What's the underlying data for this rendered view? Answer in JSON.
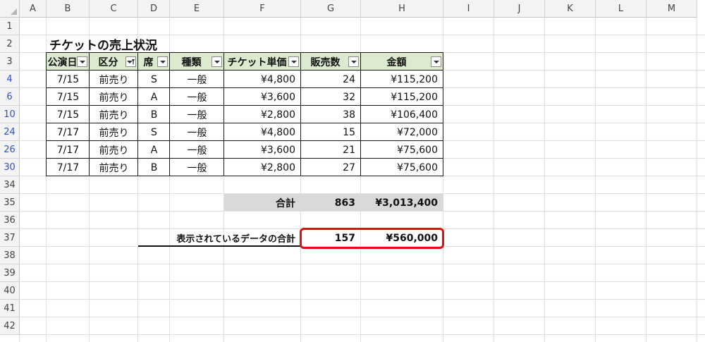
{
  "column_headers": [
    "A",
    "B",
    "C",
    "D",
    "E",
    "F",
    "G",
    "H",
    "I",
    "J",
    "K",
    "L",
    "M"
  ],
  "row_headers": [
    "1",
    "2",
    "3",
    "4",
    "6",
    "10",
    "24",
    "26",
    "30",
    "34",
    "35",
    "36",
    "37",
    "38",
    "39",
    "40",
    "41",
    "42"
  ],
  "title": "チケットの売上状況",
  "table": {
    "headers": [
      "公演日",
      "区分",
      "席",
      "種類",
      "チケット単価",
      "販売数",
      "金額"
    ],
    "rows": [
      [
        "7/15",
        "前売り",
        "S",
        "一般",
        "¥4,800",
        "24",
        "¥115,200"
      ],
      [
        "7/15",
        "前売り",
        "A",
        "一般",
        "¥3,600",
        "32",
        "¥115,200"
      ],
      [
        "7/15",
        "前売り",
        "B",
        "一般",
        "¥2,800",
        "38",
        "¥106,400"
      ],
      [
        "7/17",
        "前売り",
        "S",
        "一般",
        "¥4,800",
        "15",
        "¥72,000"
      ],
      [
        "7/17",
        "前売り",
        "A",
        "一般",
        "¥3,600",
        "21",
        "¥75,600"
      ],
      [
        "7/17",
        "前売り",
        "B",
        "一般",
        "¥2,800",
        "27",
        "¥75,600"
      ]
    ]
  },
  "total": {
    "label": "合計",
    "count": "863",
    "amount": "¥3,013,400"
  },
  "visible_total": {
    "label": "表示されているデータの合計",
    "count": "157",
    "amount": "¥560,000"
  },
  "colors": {
    "header_fill": "#dcebcf",
    "total_fill": "#d9d9d9",
    "highlight": "#e01010",
    "filtered_row_number": "#2f52c9"
  }
}
